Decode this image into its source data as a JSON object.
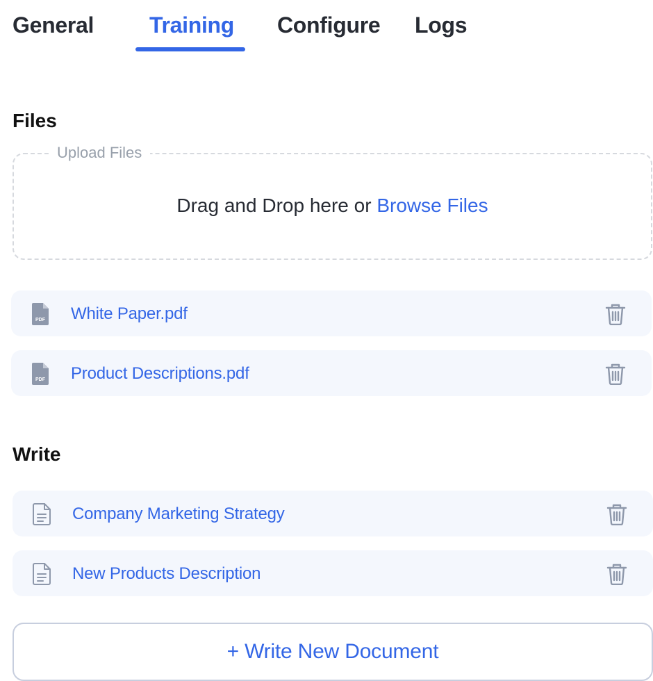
{
  "tabs": [
    {
      "label": "General",
      "active": false
    },
    {
      "label": "Training",
      "active": true
    },
    {
      "label": "Configure",
      "active": false
    },
    {
      "label": "Logs",
      "active": false
    }
  ],
  "files_section": {
    "title": "Files",
    "upload": {
      "legend": "Upload Files",
      "prompt": "Drag and Drop here or ",
      "browse_label": "Browse Files"
    },
    "items": [
      {
        "name": "White Paper.pdf",
        "icon": "pdf-file-icon",
        "badge": "PDF"
      },
      {
        "name": "Product Descriptions.pdf",
        "icon": "pdf-file-icon",
        "badge": "PDF"
      }
    ]
  },
  "write_section": {
    "title": "Write",
    "items": [
      {
        "name": "Company Marketing Strategy",
        "icon": "document-icon"
      },
      {
        "name": "New Products Description",
        "icon": "document-icon"
      }
    ],
    "new_button_label": "+ Write New Document"
  },
  "colors": {
    "accent": "#3366e6",
    "text": "#272b33",
    "item_background": "#f4f7fd",
    "icon_gray": "#8e98ab"
  }
}
